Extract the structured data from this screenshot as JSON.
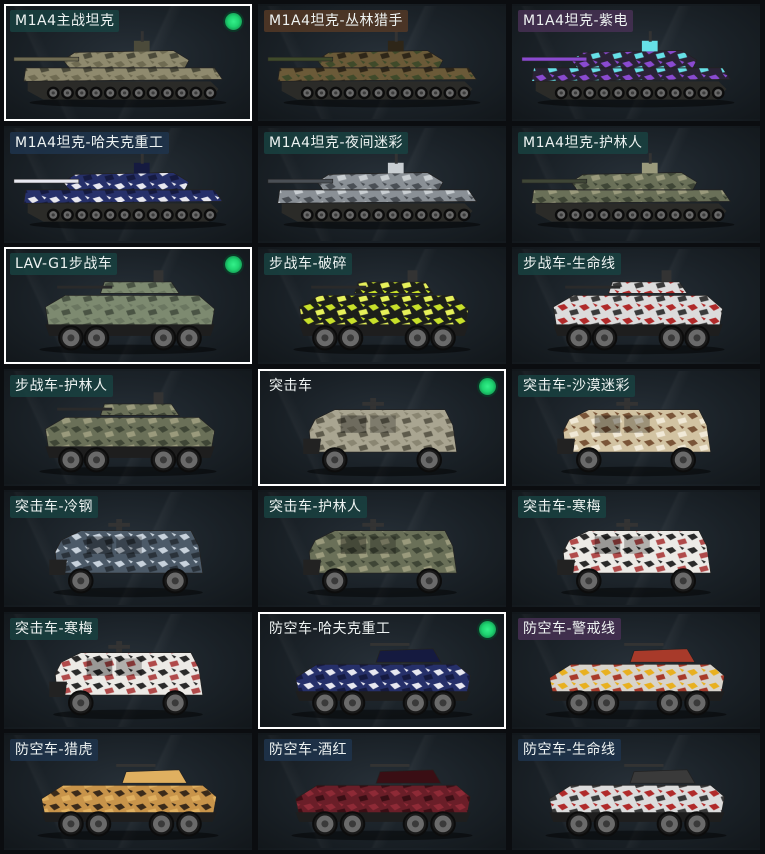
{
  "skins": [
    {
      "label": "M1A4主战坦克",
      "kind": "tank",
      "pattern": "sand",
      "tag": "teal",
      "selected": true,
      "equipped": true
    },
    {
      "label": "M1A4坦克-丛林猎手",
      "kind": "tank",
      "pattern": "jungle",
      "tag": "brown",
      "selected": false,
      "equipped": false
    },
    {
      "label": "M1A4坦克-紫电",
      "kind": "tank",
      "pattern": "purple",
      "tag": "purple",
      "selected": false,
      "equipped": false
    },
    {
      "label": "M1A4坦克-哈夫克重工",
      "kind": "tank",
      "pattern": "navy",
      "tag": "navy",
      "selected": false,
      "equipped": false
    },
    {
      "label": "M1A4坦克-夜间迷彩",
      "kind": "tank",
      "pattern": "night",
      "tag": "teal",
      "selected": false,
      "equipped": false
    },
    {
      "label": "M1A4坦克-护林人",
      "kind": "tank",
      "pattern": "forest",
      "tag": "teal",
      "selected": false,
      "equipped": false
    },
    {
      "label": "LAV-G1步战车",
      "kind": "ifv",
      "pattern": "olive",
      "tag": "teal",
      "selected": true,
      "equipped": true
    },
    {
      "label": "步战车-破碎",
      "kind": "ifv",
      "pattern": "lime",
      "tag": "teal",
      "selected": false,
      "equipped": false
    },
    {
      "label": "步战车-生命线",
      "kind": "ifv",
      "pattern": "lifeline",
      "tag": "teal",
      "selected": false,
      "equipped": false
    },
    {
      "label": "步战车-护林人",
      "kind": "ifv",
      "pattern": "forest",
      "tag": "teal",
      "selected": false,
      "equipped": false
    },
    {
      "label": "突击车",
      "kind": "assault",
      "pattern": "stone",
      "tag": "none",
      "selected": true,
      "equipped": true
    },
    {
      "label": "突击车-沙漠迷彩",
      "kind": "assault",
      "pattern": "desert",
      "tag": "teal",
      "selected": false,
      "equipped": false
    },
    {
      "label": "突击车-冷钢",
      "kind": "assault",
      "pattern": "steel",
      "tag": "teal",
      "selected": false,
      "equipped": false
    },
    {
      "label": "突击车-护林人",
      "kind": "assault",
      "pattern": "forest",
      "tag": "teal",
      "selected": false,
      "equipped": false
    },
    {
      "label": "突击车-寒梅",
      "kind": "assault",
      "pattern": "plum",
      "tag": "teal",
      "selected": false,
      "equipped": false
    },
    {
      "label": "突击车-寒梅",
      "kind": "assault",
      "pattern": "plum",
      "tag": "teal",
      "selected": false,
      "equipped": false
    },
    {
      "label": "防空车-哈夫克重工",
      "kind": "aa",
      "pattern": "navy",
      "tag": "none",
      "selected": true,
      "equipped": true
    },
    {
      "label": "防空车-警戒线",
      "kind": "aa",
      "pattern": "caution",
      "tag": "purple",
      "selected": false,
      "equipped": false
    },
    {
      "label": "防空车-猎虎",
      "kind": "aa",
      "pattern": "tiger",
      "tag": "navy",
      "selected": false,
      "equipped": false
    },
    {
      "label": "防空车-酒红",
      "kind": "aa",
      "pattern": "wine",
      "tag": "navy",
      "selected": false,
      "equipped": false
    },
    {
      "label": "防空车-生命线",
      "kind": "aa",
      "pattern": "lifeline",
      "tag": "navy",
      "selected": false,
      "equipped": false
    }
  ],
  "palettes": {
    "sand": {
      "base": "#8f8a6e",
      "spot": "#6f6b52",
      "dark": "#4b4a3a"
    },
    "jungle": {
      "base": "#6b5a38",
      "spot": "#3f4a2a",
      "dark": "#2e2618"
    },
    "purple": {
      "base": "#2a2336",
      "spot": "#8a4ad0",
      "dark": "#66e0e6"
    },
    "navy": {
      "base": "#26306a",
      "spot": "#e8e8f0",
      "dark": "#151a40"
    },
    "night": {
      "base": "#8a9096",
      "spot": "#4a4f55",
      "dark": "#c9ced2"
    },
    "forest": {
      "base": "#6a7058",
      "spot": "#3f4636",
      "dark": "#9a9a7c"
    },
    "olive": {
      "base": "#7d8a70",
      "spot": "#6a7660",
      "dark": "#4a5444"
    },
    "lime": {
      "base": "#1c1f1a",
      "spot": "#c8e02a",
      "dark": "#e6f05a"
    },
    "lifeline": {
      "base": "#dcdcdc",
      "spot": "#b02a2a",
      "dark": "#3a3a3a"
    },
    "stone": {
      "base": "#a9a591",
      "spot": "#8a8672",
      "dark": "#5e5b4c"
    },
    "desert": {
      "base": "#d2c3a2",
      "spot": "#7a5538",
      "dark": "#f0e8d6"
    },
    "steel": {
      "base": "#4c5a68",
      "spot": "#c8d2dc",
      "dark": "#2a323a"
    },
    "plum": {
      "base": "#eceae6",
      "spot": "#2a2a2a",
      "dark": "#b04a4a"
    },
    "caution": {
      "base": "#d8d4cc",
      "spot": "#e8b020",
      "dark": "#a83a2a"
    },
    "tiger": {
      "base": "#c8944a",
      "spot": "#3a2a1a",
      "dark": "#e0b060"
    },
    "wine": {
      "base": "#6a1e28",
      "spot": "#8e2a36",
      "dark": "#3a0e14"
    }
  }
}
